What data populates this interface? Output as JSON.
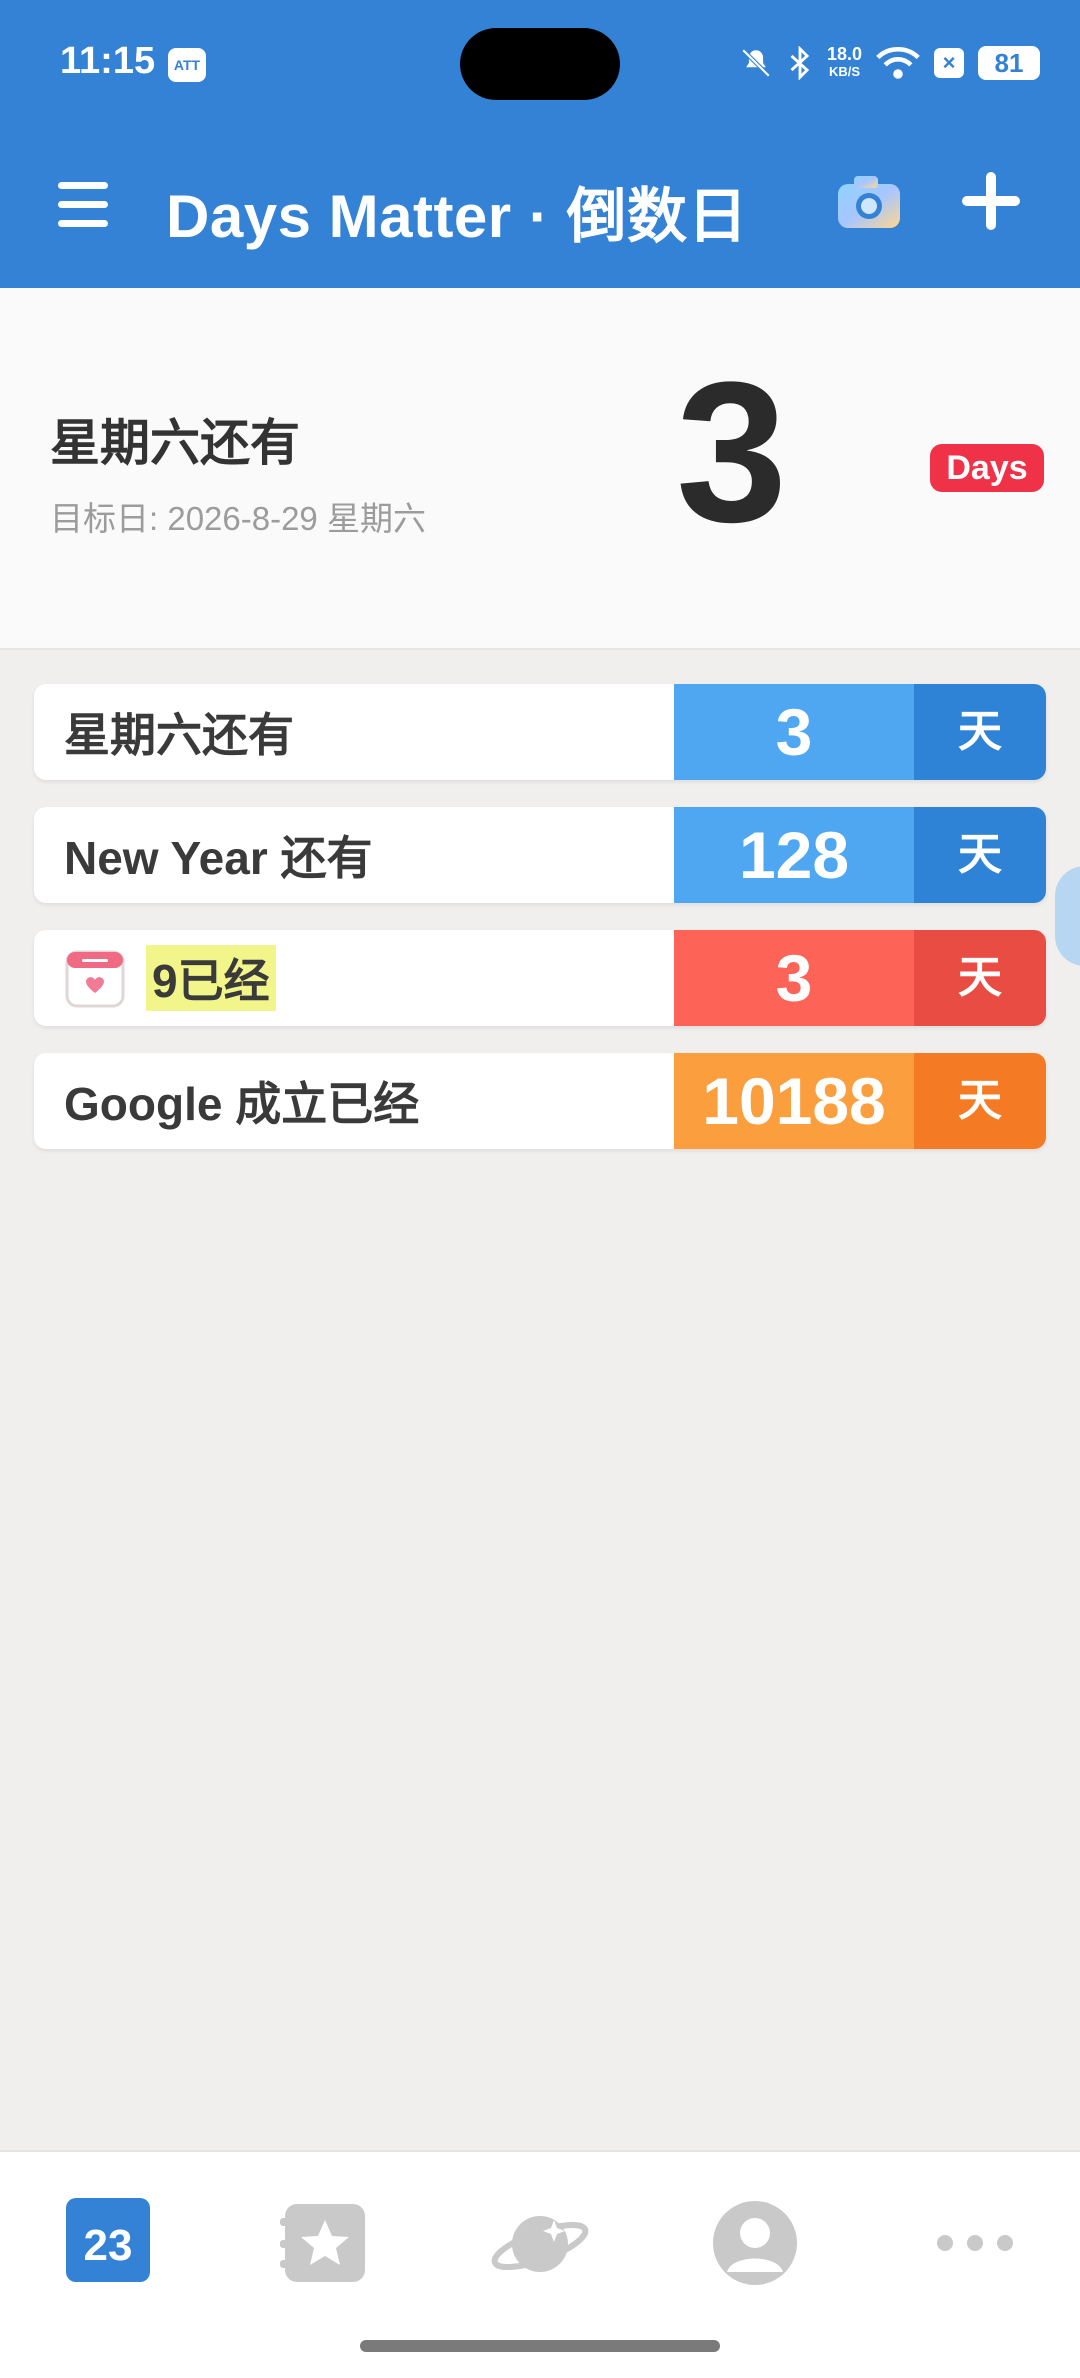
{
  "status": {
    "time": "11:15",
    "app_badge": "ATT",
    "speed_top": "18.0",
    "speed_unit": "KB/S",
    "battery": "81"
  },
  "appbar": {
    "title": "Days Matter · 倒数日"
  },
  "hero": {
    "title": "星期六还有",
    "subtitle": "目标日: 2026-8-29 星期六",
    "count": "3",
    "unit": "Days"
  },
  "items": [
    {
      "title": "星期六还有",
      "count": "3",
      "unit": "天",
      "count_color": "#4FA7F2",
      "unit_color": "#2F83D6"
    },
    {
      "title": "New Year 还有",
      "count": "128",
      "unit": "天",
      "count_color": "#4FA7F2",
      "unit_color": "#2F83D6"
    },
    {
      "title": "9已经",
      "count": "3",
      "unit": "天",
      "count_color": "#FE6357",
      "unit_color": "#E94C42"
    },
    {
      "title": "Google 成立已经",
      "count": "10188",
      "unit": "天",
      "count_color": "#FB9E3D",
      "unit_color": "#F57A24"
    }
  ],
  "bottom_nav": {
    "calendar_day": "23"
  }
}
